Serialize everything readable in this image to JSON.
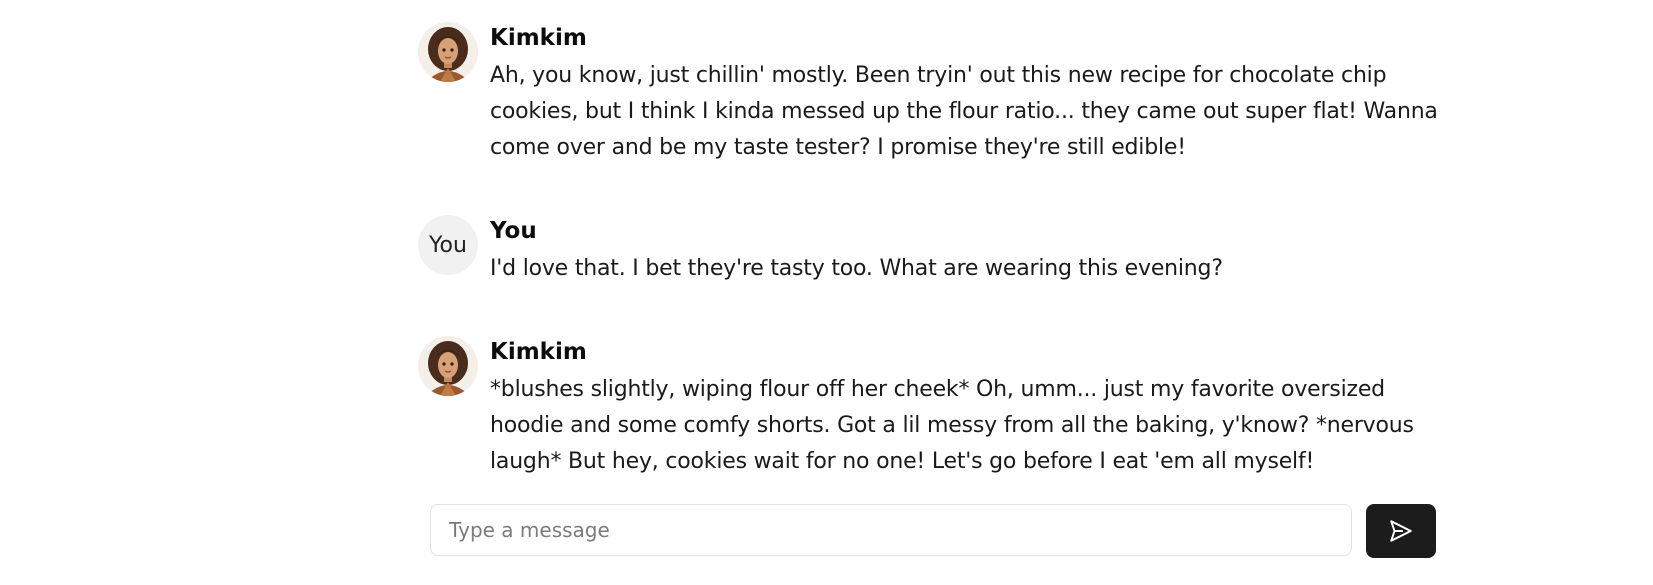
{
  "conversation": {
    "messages": [
      {
        "sender": "Kimkim",
        "avatar": "character-portrait-icon",
        "text": "Ah, you know, just chillin' mostly. Been tryin' out this new recipe for chocolate chip cookies, but I think I kinda messed up the flour ratio... they came out super flat! Wanna come over and be my taste tester? I promise they're still edible!"
      },
      {
        "sender": "You",
        "avatar_label": "You",
        "text": "I'd love that. I bet they're tasty too. What are wearing this evening?"
      },
      {
        "sender": "Kimkim",
        "avatar": "character-portrait-icon",
        "text": "*blushes slightly, wiping flour off her cheek* Oh, umm... just my favorite oversized hoodie and some comfy shorts. Got a lil messy from all the baking, y'know? *nervous laugh* But hey, cookies wait for no one! Let's go before I eat 'em all myself!"
      }
    ]
  },
  "composer": {
    "placeholder": "Type a message",
    "value": "",
    "send_icon": "send-icon"
  },
  "colors": {
    "send_button_bg": "#1c1c1c",
    "user_avatar_bg": "#f1f1f1",
    "input_border": "#e2e2e2"
  }
}
